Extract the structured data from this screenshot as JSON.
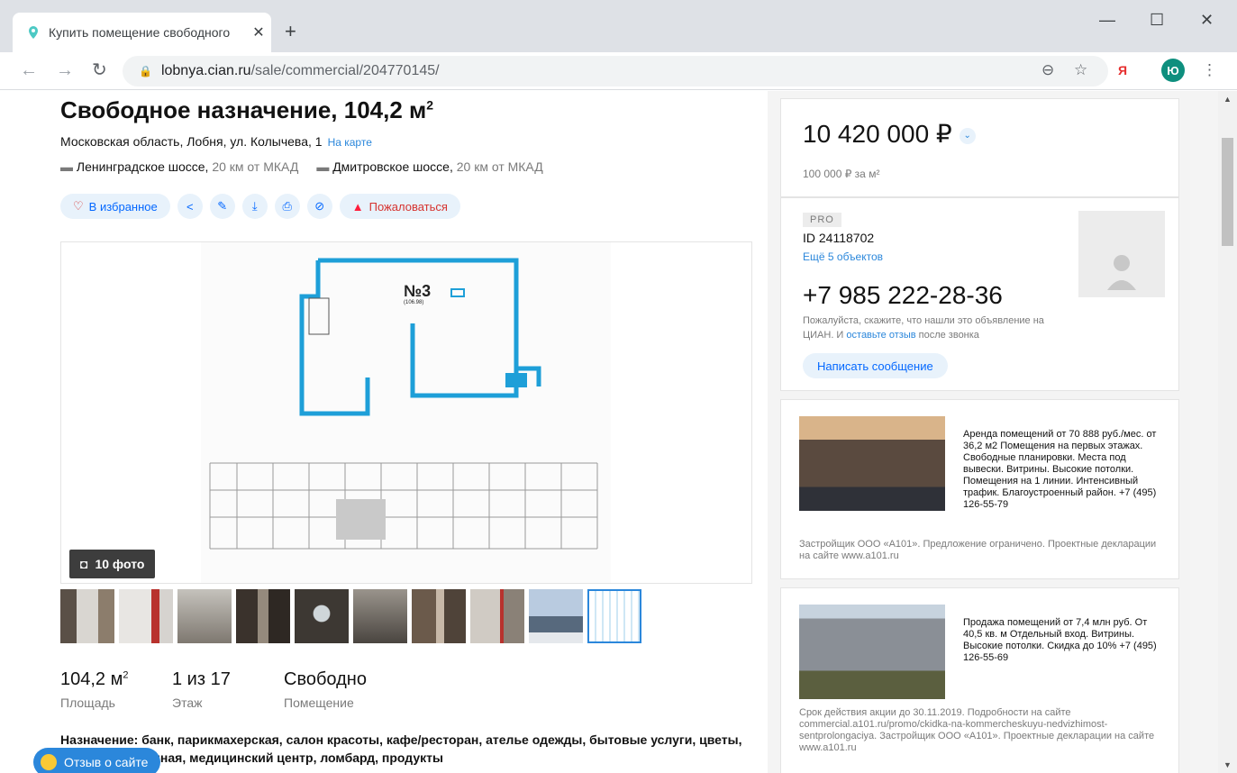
{
  "browser": {
    "tab_title": "Купить помещение свободного",
    "url_host": "lobnya.cian.ru",
    "url_path": "/sale/commercial/204770145/",
    "profile_initial": "Ю",
    "yandex_label": "Я"
  },
  "listing": {
    "title": "Свободное назначение, 104,2 м",
    "title_sup": "2",
    "address": "Московская область, Лобня, ул. Колычева, 1",
    "map_link": "На карте",
    "highways": [
      {
        "name": "Ленинградское шоссе,",
        "dist": "20 км от МКАД"
      },
      {
        "name": "Дмитровское шоссе,",
        "dist": "20 км от МКАД"
      }
    ],
    "actions": {
      "favorite": "В избранное",
      "complain": "Пожаловаться"
    },
    "photo_count": "10 фото",
    "plan_label": "№3",
    "plan_area": "(106.98)",
    "stats": [
      {
        "value": "104,2 м",
        "sup": "2",
        "label": "Площадь"
      },
      {
        "value": "1 из 17",
        "sup": "",
        "label": "Этаж"
      },
      {
        "value": "Свободно",
        "sup": "",
        "label": "Помещение"
      }
    ],
    "purpose": "Назначение: банк, парикмахерская, салон красоты, кафе/ресторан, ателье одежды, бытовые услуги, цветы, фрукты, кальянная, медицинский центр, ломбард, продукты",
    "purpose_line2": "цветы, фрукты, кальянная, медицинский центр, ломбард, продукты"
  },
  "feedback_label": "Отзыв о сайте",
  "price": {
    "amount": "10 420 000 ₽",
    "per_m2": "100 000 ₽ за м²"
  },
  "agent": {
    "badge": "PRO",
    "id": "ID 24118702",
    "more": "Ещё 5 объектов",
    "phone": "+7 985 222-28-36",
    "note_a": "Пожалуйста, скажите, что нашли это объявление на ЦИАН. И ",
    "note_link": "оставьте отзыв",
    "note_b": " после звонка",
    "message_btn": "Написать сообщение"
  },
  "ads": [
    {
      "text": "Аренда помещений от 70 888 руб./мес. от 36,2 м2 Помещения на первых этажах. Свободные планировки. Места под вывески. Витрины. Высокие потолки. Помещения на 1 линии. Интенсивный трафик. Благоустроенный район. +7 (495) 126-55-79",
      "fine": "Застройщик ООО «А101». Предложение ограничено. Проектные декларации на сайте www.a101.ru"
    },
    {
      "text": "Продажа помещений от 7,4 млн руб. От 40,5 кв. м Отдельный вход. Витрины. Высокие потолки. Скидка до 10% +7 (495) 126-55-69",
      "fine": "Срок действия акции до 30.11.2019. Подробности на сайте commercial.a101.ru/promo/ckidka-na-kommercheskuyu-nedvizhimost-sentprolongaciya. Застройщик ООО «А101». Проектные декларации на сайте www.a101.ru"
    }
  ]
}
